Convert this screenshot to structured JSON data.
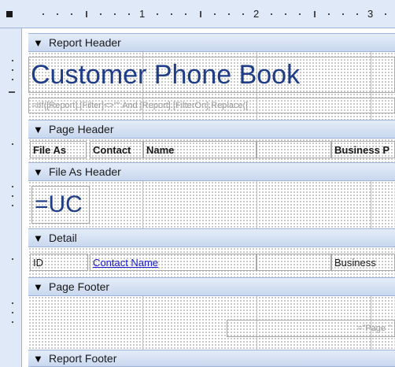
{
  "sections": {
    "report_header": "Report Header",
    "page_header": "Page Header",
    "file_as_header": "File As Header",
    "detail": "Detail",
    "page_footer": "Page Footer",
    "report_footer": "Report Footer"
  },
  "ruler": {
    "n1": "1",
    "n2": "2",
    "n3": "3"
  },
  "report_header": {
    "title": "Customer Phone Book",
    "filter_expr": "=IIf([Report].[Filter]<>\"\" And [Report].[FilterOn],Replace(["
  },
  "page_header": {
    "file_as": "File As",
    "contact": "Contact",
    "name": "Name",
    "business": "Business P"
  },
  "file_as_header": {
    "expr": "=UC"
  },
  "detail": {
    "id": "ID",
    "contact_name": "Contact Name",
    "business": "Business"
  },
  "page_footer": {
    "page_expr": "=\"Page \""
  },
  "icons": {
    "section_arrow": "arrow-icon"
  }
}
